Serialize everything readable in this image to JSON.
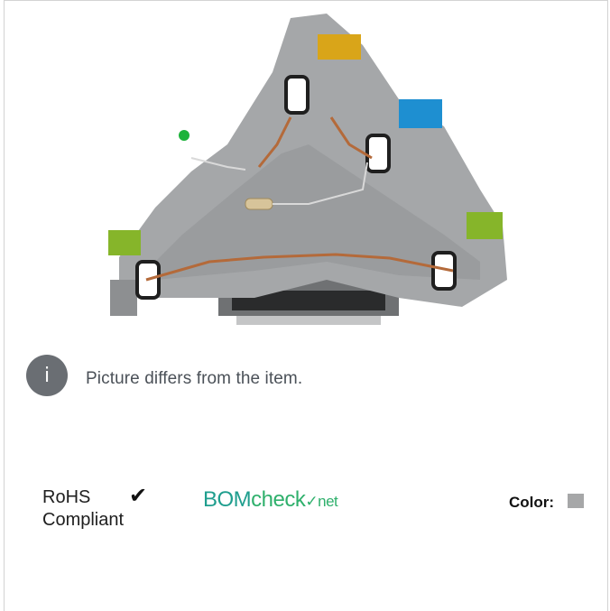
{
  "info": {
    "icon_glyph": "i",
    "note": "Picture differs from the item."
  },
  "rohs": {
    "line1": "RoHS",
    "line2": "Compliant",
    "check": "✔"
  },
  "bomcheck": {
    "part1": "BOM",
    "part2": "check",
    "part3": "✓net"
  },
  "color": {
    "label": "Color:",
    "swatch_hex": "#a6a7a8"
  }
}
